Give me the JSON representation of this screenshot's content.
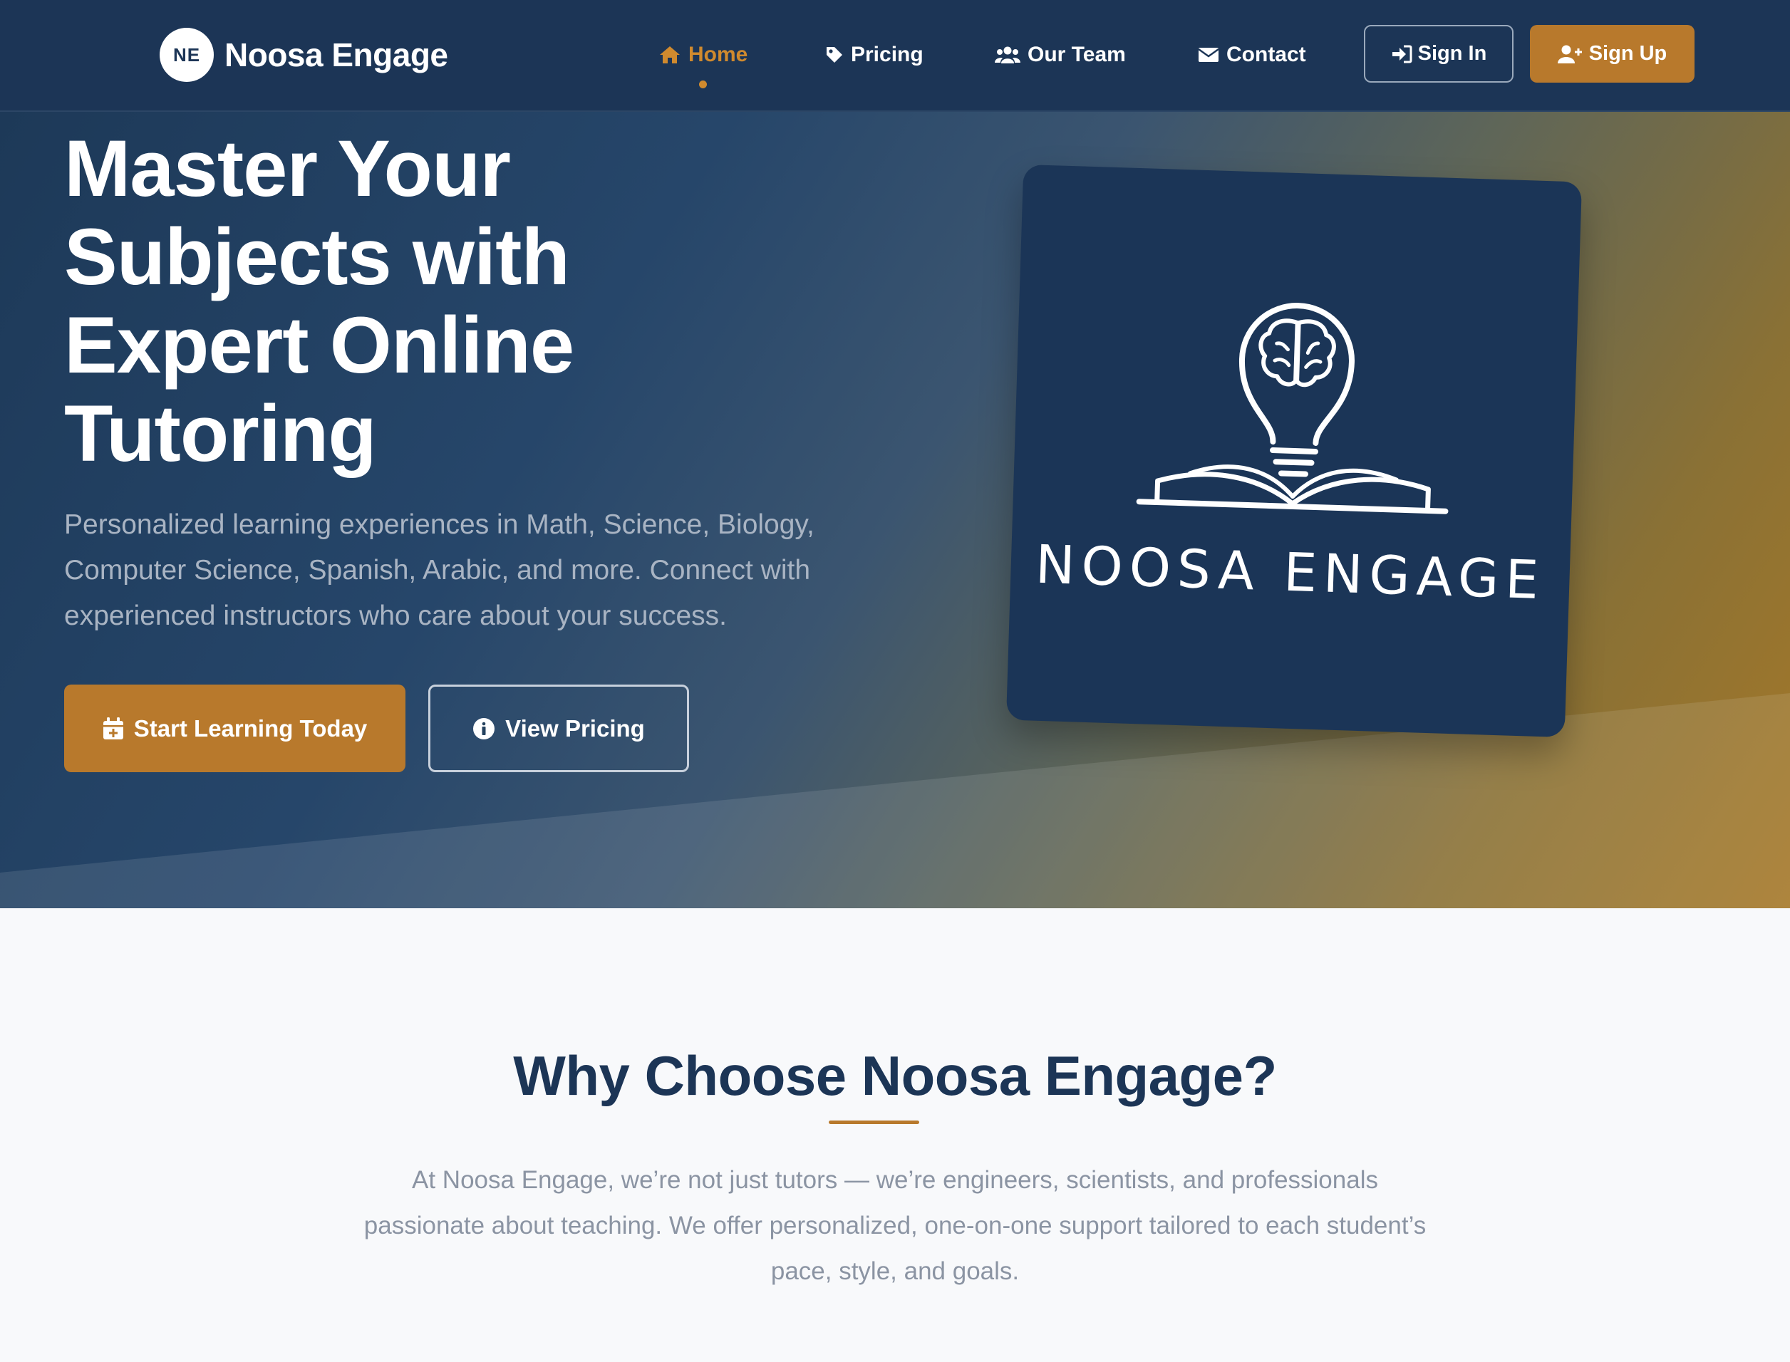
{
  "brand": {
    "initials": "NE",
    "name": "Noosa Engage"
  },
  "nav": {
    "home": "Home",
    "pricing": "Pricing",
    "team": "Our Team",
    "contact": "Contact",
    "signin": "Sign In",
    "signup": "Sign Up"
  },
  "hero": {
    "title": "Master Your Subjects with Expert Online Tutoring",
    "subtitle": "Personalized learning experiences in Math, Science, Biology, Computer Science, Spanish, Arabic, and more. Connect with experienced instructors who care about your success.",
    "primary_button": "Start Learning Today",
    "secondary_button": "View Pricing",
    "logo_wordmark": "NOOSA ENGAGE"
  },
  "why": {
    "title": "Why Choose Noosa Engage?",
    "text": "At Noosa Engage, we’re not just tutors — we’re engineers, scientists, and professionals passionate about teaching. We offer personalized, one-on-one support tailored to each student’s pace, style, and goals."
  },
  "colors": {
    "navy": "#1c3556",
    "accent": "#b8792c",
    "active_link": "#d08a2e",
    "muted_text": "#8b94a3"
  },
  "icons": {
    "home": "home-icon",
    "pricing": "tag-icon",
    "team": "users-icon",
    "contact": "envelope-icon",
    "signin": "sign-in-icon",
    "signup": "user-plus-icon",
    "start": "calendar-plus-icon",
    "view": "info-circle-icon",
    "logo": "lightbulb-brain-book-icon"
  }
}
